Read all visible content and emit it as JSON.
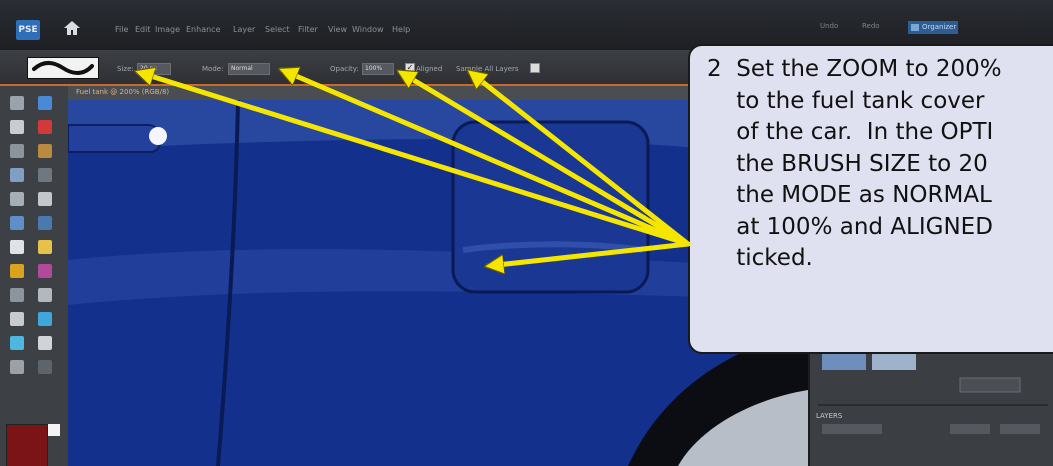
{
  "app": {
    "logo_text": "PSE"
  },
  "menu": [
    "File",
    "Edit",
    "Image",
    "Enhance",
    "Layer",
    "Select",
    "Filter",
    "View",
    "Window",
    "Help"
  ],
  "window_buttons": {
    "undo": "Undo",
    "redo": "Redo",
    "organizer": "Organizer"
  },
  "options_bar": {
    "size_label": "Size:",
    "size_value": "20 px",
    "mode_label": "Mode:",
    "mode_value": "Normal",
    "opacity_label": "Opacity:",
    "opacity_value": "100%",
    "aligned_label": "Aligned",
    "aligned_checked": true,
    "sample_label": "Sample All Layers"
  },
  "document": {
    "title": "Fuel tank @ 200% (RGB/8)"
  },
  "panel": {
    "layers_header": "LAYERS"
  },
  "colors": {
    "foreground": "#7a1416",
    "background": "#f4f4f4",
    "accent": "#c96a2a",
    "arrow": "#f5e600"
  },
  "callout": {
    "lines": [
      "2  Set the ZOOM to 200%",
      "    to the fuel tank cover",
      "    of the car.  In the OPTI",
      "    the BRUSH SIZE to 20",
      "    the MODE as NORMAL",
      "    at 100% and ALIGNED",
      "    ticked."
    ]
  }
}
